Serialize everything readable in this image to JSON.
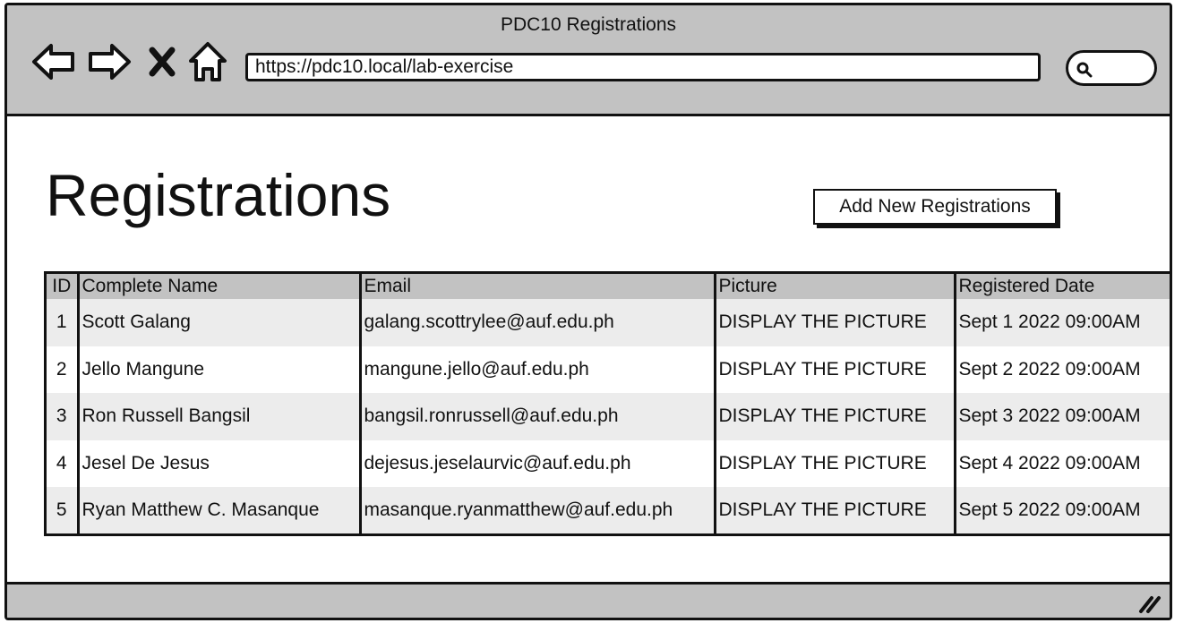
{
  "window": {
    "title": "PDC10 Registrations"
  },
  "toolbar": {
    "url": "https://pdc10.local/lab-exercise",
    "icons": [
      "back-arrow-icon",
      "forward-arrow-icon",
      "close-icon",
      "home-icon",
      "search-icon"
    ]
  },
  "page": {
    "title": "Registrations",
    "add_button_label": "Add New Registrations"
  },
  "table": {
    "columns": [
      "ID",
      "Complete Name",
      "Email",
      "Picture",
      "Registered Date"
    ],
    "rows": [
      {
        "id": "1",
        "name": "Scott Galang",
        "email": "galang.scottrylee@auf.edu.ph",
        "picture": "DISPLAY THE PICTURE",
        "date": "Sept 1 2022 09:00AM"
      },
      {
        "id": "2",
        "name": "Jello Mangune",
        "email": "mangune.jello@auf.edu.ph",
        "picture": "DISPLAY THE PICTURE",
        "date": "Sept 2 2022 09:00AM"
      },
      {
        "id": "3",
        "name": "Ron Russell Bangsil",
        "email": "bangsil.ronrussell@auf.edu.ph",
        "picture": "DISPLAY THE PICTURE",
        "date": "Sept 3 2022 09:00AM"
      },
      {
        "id": "4",
        "name": "Jesel De Jesus",
        "email": "dejesus.jeselaurvic@auf.edu.ph",
        "picture": "DISPLAY THE PICTURE",
        "date": "Sept 4 2022 09:00AM"
      },
      {
        "id": "5",
        "name": "Ryan Matthew C. Masanque",
        "email": "masanque.ryanmatthew@auf.edu.ph",
        "picture": "DISPLAY THE PICTURE",
        "date": "Sept 5 2022 09:00AM"
      }
    ]
  },
  "colors": {
    "chrome": "#c2c2c2",
    "stroke": "#111111",
    "row_alt": "#ececec"
  }
}
